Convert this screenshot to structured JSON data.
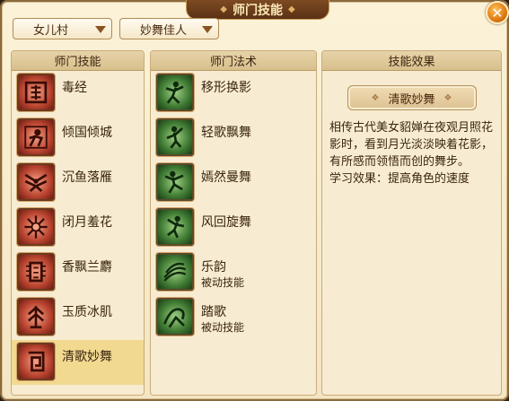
{
  "window": {
    "title": "师门技能"
  },
  "dropdowns": {
    "village": "女儿村",
    "school": "妙舞佳人"
  },
  "skills_panel": {
    "header": "师门技能",
    "items": [
      {
        "label": "毒经",
        "icon": "poison-scroll-icon"
      },
      {
        "label": "倾国倾城",
        "icon": "charm-figure-icon"
      },
      {
        "label": "沉鱼落雁",
        "icon": "fish-bird-icon"
      },
      {
        "label": "闭月羞花",
        "icon": "moon-flower-icon"
      },
      {
        "label": "香飘兰麝",
        "icon": "fragrance-icon"
      },
      {
        "label": "玉质冰肌",
        "icon": "jade-figure-icon"
      },
      {
        "label": "清歌妙舞",
        "icon": "dance-glyph-icon",
        "selected": true
      }
    ]
  },
  "spells_panel": {
    "header": "师门法术",
    "items": [
      {
        "label": "移形换影",
        "sub": "",
        "icon": "shadow-dancer-icon"
      },
      {
        "label": "轻歌飘舞",
        "sub": "",
        "icon": "light-dance-icon"
      },
      {
        "label": "嫣然曼舞",
        "sub": "",
        "icon": "graceful-dance-icon"
      },
      {
        "label": "风回旋舞",
        "sub": "",
        "icon": "whirl-dance-icon"
      },
      {
        "label": "乐韵",
        "sub": "被动技能",
        "icon": "melody-icon"
      },
      {
        "label": "踏歌",
        "sub": "被动技能",
        "icon": "step-song-icon"
      }
    ]
  },
  "effect_panel": {
    "header": "技能效果",
    "skill_name": "清歌妙舞",
    "description": "相传古代美女貂婵在夜观月照花影时，看到月光淡淡映着花影，有所感而领悟而创的舞步。",
    "learn_effect": "学习效果：提高角色的速度"
  },
  "colors": {
    "accent": "#e07a12",
    "selected_row": "#f1d990",
    "title_bar": "#6a3a18"
  }
}
